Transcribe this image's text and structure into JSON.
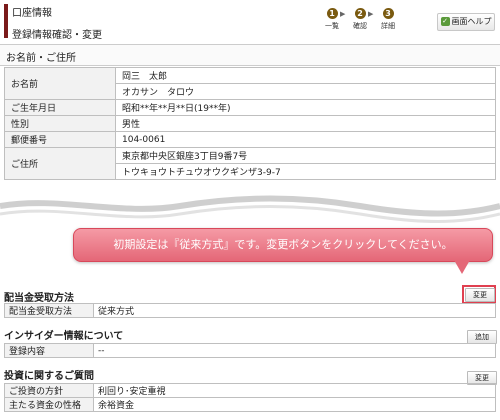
{
  "header": {
    "section": "口座情報",
    "page_title": "登録情報確認・変更",
    "help_button": "画面ヘルプ",
    "steps": [
      {
        "num": "1",
        "label": "一覧"
      },
      {
        "num": "2",
        "label": "確認"
      },
      {
        "num": "3",
        "label": "詳細"
      }
    ]
  },
  "name_address": {
    "heading": "お名前・ご住所",
    "rows": [
      {
        "label": "お名前",
        "values": [
          "岡三　太郎",
          "オカサン　タロウ"
        ]
      },
      {
        "label": "ご生年月日",
        "values": [
          "昭和**年**月**日(19**年)"
        ]
      },
      {
        "label": "性別",
        "values": [
          "男性"
        ]
      },
      {
        "label": "郵便番号",
        "values": [
          "104-0061"
        ]
      },
      {
        "label": "ご住所",
        "values": [
          "東京都中央区銀座3丁目9番7号",
          "トウキョウトチュウオウクギンザ3-9-7"
        ]
      }
    ]
  },
  "callout": {
    "text": "初期設定は『従来方式』です。変更ボタンをクリックしてください。"
  },
  "dividend": {
    "heading": "配当金受取方法",
    "button": "変更",
    "label": "配当金受取方法",
    "value": "従来方式"
  },
  "insider": {
    "heading": "インサイダー情報について",
    "button": "追加",
    "label": "登録内容",
    "value": "--"
  },
  "investment": {
    "heading": "投資に関するご質問",
    "button": "変更",
    "rows": [
      {
        "label": "ご投資の方針",
        "value": "利回り･安定重視"
      },
      {
        "label": "主たる資金の性格",
        "value": "余裕資金"
      }
    ]
  }
}
